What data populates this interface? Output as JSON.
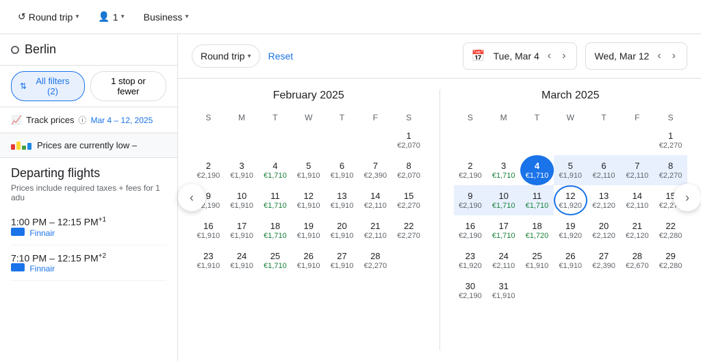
{
  "topbar": {
    "trip_type": "Round trip",
    "passengers": "1",
    "cabin": "Business"
  },
  "search": {
    "city": "Berlin"
  },
  "filters": {
    "all_filters_label": "All filters (2)",
    "stops_label": "1 stop or fewer"
  },
  "track_prices": {
    "label": "Track prices",
    "date_range": "Mar 4 – 12, 2025"
  },
  "price_info": {
    "label": "Prices are currently low –"
  },
  "departing": {
    "title": "Departing flights",
    "subtitle": "Prices include required taxes + fees for 1 adu",
    "flights": [
      {
        "time": "1:00 PM – 12:15 PM",
        "superscript": "+1",
        "airline": "Finnair"
      },
      {
        "time": "7:10 PM – 12:15 PM",
        "superscript": "+2",
        "airline": "Finnair"
      }
    ]
  },
  "calendar_overlay": {
    "round_trip_label": "Round trip",
    "reset_label": "Reset",
    "depart_date": "Tue, Mar 4",
    "return_date": "Wed, Mar 12",
    "feb_title": "February 2025",
    "mar_title": "March 2025",
    "day_headers": [
      "S",
      "M",
      "T",
      "W",
      "T",
      "F",
      "S"
    ],
    "feb_weeks": [
      [
        null,
        null,
        null,
        null,
        null,
        null,
        {
          "d": 1,
          "p": "€2,070",
          "low": false
        }
      ],
      [
        {
          "d": 2,
          "p": "€2,190",
          "low": false
        },
        {
          "d": 3,
          "p": "€1,910",
          "low": false
        },
        {
          "d": 4,
          "p": "€1,710",
          "low": true
        },
        {
          "d": 5,
          "p": "€1,910",
          "low": false
        },
        {
          "d": 6,
          "p": "€1,910",
          "low": false
        },
        {
          "d": 7,
          "p": "€2,390",
          "low": false
        },
        {
          "d": 8,
          "p": "€2,070",
          "low": false
        }
      ],
      [
        {
          "d": 9,
          "p": "€2,190",
          "low": false
        },
        {
          "d": 10,
          "p": "€1,910",
          "low": false
        },
        {
          "d": 11,
          "p": "€1,710",
          "low": true
        },
        {
          "d": 12,
          "p": "€1,910",
          "low": false
        },
        {
          "d": 13,
          "p": "€1,910",
          "low": false
        },
        {
          "d": 14,
          "p": "€2,110",
          "low": false
        },
        {
          "d": 15,
          "p": "€2,270",
          "low": false
        }
      ],
      [
        {
          "d": 16,
          "p": "€1,910",
          "low": false
        },
        {
          "d": 17,
          "p": "€1,910",
          "low": false
        },
        {
          "d": 18,
          "p": "€1,710",
          "low": true
        },
        {
          "d": 19,
          "p": "€1,910",
          "low": false
        },
        {
          "d": 20,
          "p": "€1,910",
          "low": false
        },
        {
          "d": 21,
          "p": "€2,110",
          "low": false
        },
        {
          "d": 22,
          "p": "€2,270",
          "low": false
        }
      ],
      [
        {
          "d": 23,
          "p": "€1,910",
          "low": false
        },
        {
          "d": 24,
          "p": "€1,910",
          "low": false
        },
        {
          "d": 25,
          "p": "€1,710",
          "low": true
        },
        {
          "d": 26,
          "p": "€1,910",
          "low": false
        },
        {
          "d": 27,
          "p": "€1,910",
          "low": false
        },
        {
          "d": 28,
          "p": "€2,270",
          "low": false
        },
        null
      ]
    ],
    "mar_weeks": [
      [
        null,
        null,
        null,
        null,
        null,
        null,
        {
          "d": 1,
          "p": "€2,270",
          "low": false
        }
      ],
      [
        {
          "d": 2,
          "p": "€2,190",
          "low": false
        },
        {
          "d": 3,
          "p": "€1,710",
          "low": true
        },
        {
          "d": 4,
          "p": "€1,710",
          "low": true,
          "sel": "start"
        },
        {
          "d": 5,
          "p": "€1,910",
          "low": false
        },
        {
          "d": 6,
          "p": "€2,110",
          "low": false
        },
        {
          "d": 7,
          "p": "€2,110",
          "low": false
        },
        {
          "d": 8,
          "p": "€2,270",
          "low": false
        }
      ],
      [
        {
          "d": 9,
          "p": "€2,190",
          "low": false
        },
        {
          "d": 10,
          "p": "€1,710",
          "low": true
        },
        {
          "d": 11,
          "p": "€1,710",
          "low": true
        },
        {
          "d": 12,
          "p": "€1,920",
          "low": false,
          "sel": "end"
        },
        {
          "d": 13,
          "p": "€2,120",
          "low": false
        },
        {
          "d": 14,
          "p": "€2,110",
          "low": false
        },
        {
          "d": 15,
          "p": "€2,270",
          "low": false
        }
      ],
      [
        {
          "d": 16,
          "p": "€2,190",
          "low": false
        },
        {
          "d": 17,
          "p": "€1,710",
          "low": true
        },
        {
          "d": 18,
          "p": "€1,720",
          "low": true
        },
        {
          "d": 19,
          "p": "€1,920",
          "low": false
        },
        {
          "d": 20,
          "p": "€2,120",
          "low": false
        },
        {
          "d": 21,
          "p": "€2,120",
          "low": false
        },
        {
          "d": 22,
          "p": "€2,280",
          "low": false
        }
      ],
      [
        {
          "d": 23,
          "p": "€1,920",
          "low": false
        },
        {
          "d": 24,
          "p": "€2,110",
          "low": false
        },
        {
          "d": 25,
          "p": "€1,910",
          "low": false
        },
        {
          "d": 26,
          "p": "€1,910",
          "low": false
        },
        {
          "d": 27,
          "p": "€2,390",
          "low": false
        },
        {
          "d": 28,
          "p": "€2,670",
          "low": false
        },
        {
          "d": 29,
          "p": "€2,280",
          "low": false
        }
      ],
      [
        {
          "d": 30,
          "p": "€2,190",
          "low": false
        },
        {
          "d": 31,
          "p": "€1,910",
          "low": false
        },
        null,
        null,
        null,
        null,
        null
      ]
    ]
  }
}
